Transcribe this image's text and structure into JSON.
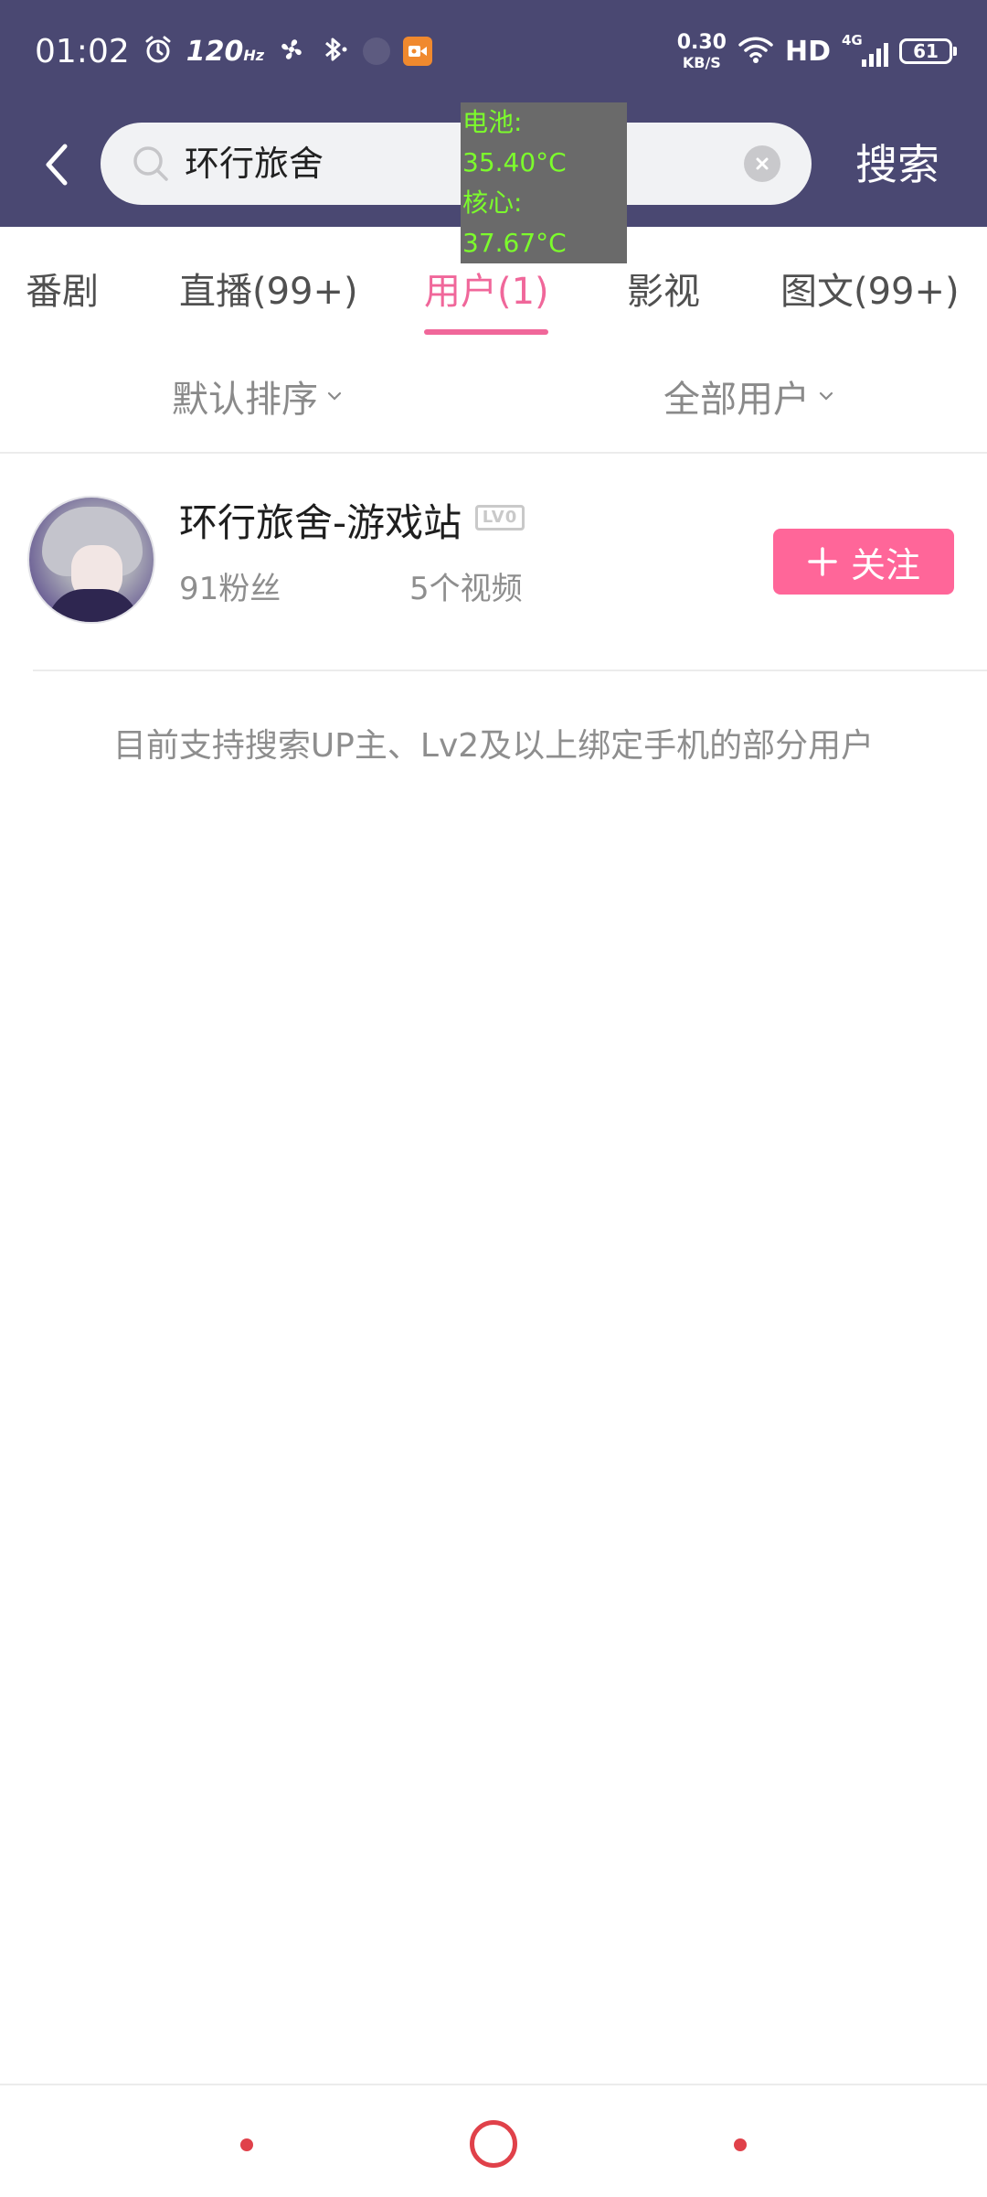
{
  "status_bar": {
    "time": "01:02",
    "refresh_rate": "120",
    "refresh_unit": "Hz",
    "net_speed_value": "0.30",
    "net_speed_unit": "KB/S",
    "network_hd": "HD",
    "network_gen": "4G",
    "battery": "61",
    "icons": [
      "alarm-icon",
      "fan-icon",
      "bluetooth-icon",
      "dimmed-app-icon",
      "screen-record-icon",
      "wifi-icon",
      "signal-icon",
      "battery-icon"
    ]
  },
  "overlay": {
    "battery_temp": "电池: 35.40°C",
    "core_temp": "核心: 37.67°C"
  },
  "header": {
    "back_icon": "chevron-left-icon",
    "query": "环行旅舍",
    "search_label": "搜索"
  },
  "tabs": [
    {
      "label": "番剧",
      "active": false
    },
    {
      "label": "直播(99+)",
      "active": false
    },
    {
      "label": "用户(1)",
      "active": true
    },
    {
      "label": "影视",
      "active": false
    },
    {
      "label": "图文(99+)",
      "active": false
    }
  ],
  "filters": {
    "sort": "默认排序",
    "user_type": "全部用户"
  },
  "results": [
    {
      "name": "环行旅舍-游戏站",
      "level": "LV0",
      "fans": "91粉丝",
      "videos": "5个视频",
      "follow_label": "关注"
    }
  ],
  "hint": "目前支持搜索UP主、Lv2及以上绑定手机的部分用户",
  "colors": {
    "header_bg": "#4a4872",
    "accent": "#f0679a",
    "follow_bg": "#ff6699",
    "overlay_text": "#7cfc2c",
    "nav_red": "#e0414a"
  }
}
